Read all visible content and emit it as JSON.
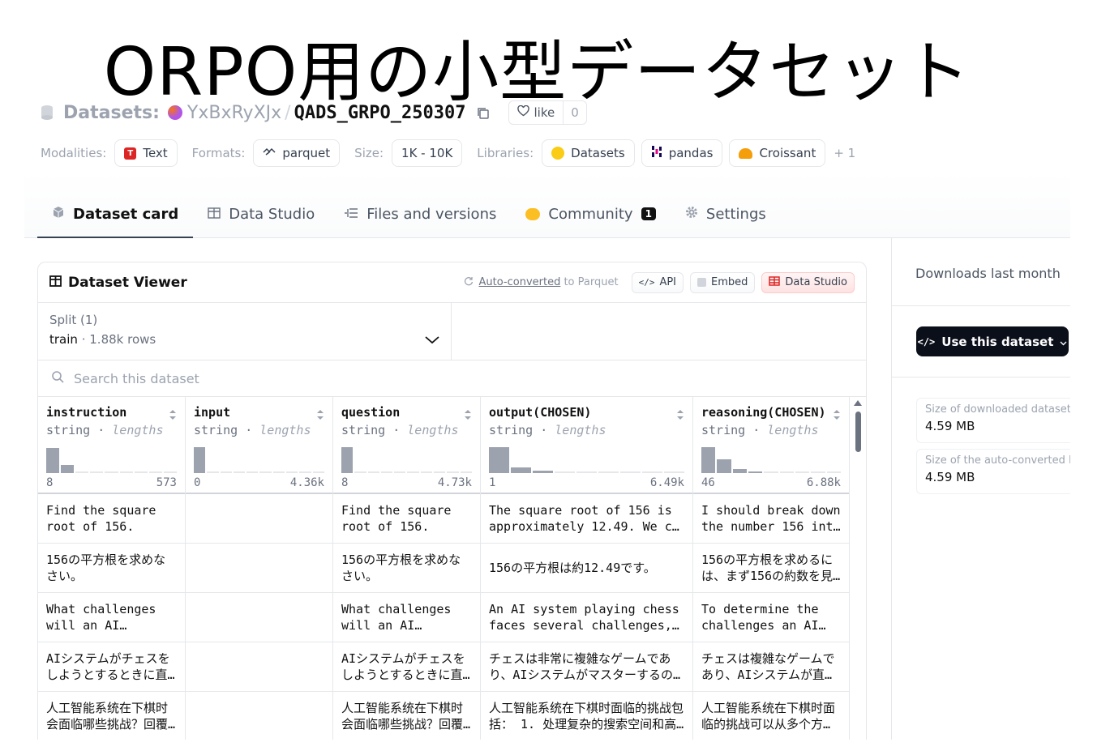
{
  "slide_title": "ORPO用の小型データセット",
  "header": {
    "label": "Datasets:",
    "owner": "YxBxRyXJx",
    "separator": "/",
    "repo": "QADS_GRPO_250307",
    "like_label": "like",
    "like_count": "0"
  },
  "tags": {
    "modalities_label": "Modalities:",
    "modality": "Text",
    "formats_label": "Formats:",
    "format": "parquet",
    "size_label": "Size:",
    "size": "1K - 10K",
    "libraries_label": "Libraries:",
    "libraries": [
      "Datasets",
      "pandas",
      "Croissant"
    ],
    "more": "+ 1"
  },
  "tabs": [
    {
      "label": "Dataset card",
      "icon": "cube-icon"
    },
    {
      "label": "Data Studio",
      "icon": "table-icon"
    },
    {
      "label": "Files and versions",
      "icon": "files-icon"
    },
    {
      "label": "Community",
      "icon": "community-icon",
      "badge": "1"
    },
    {
      "label": "Settings",
      "icon": "gear-icon"
    }
  ],
  "viewer": {
    "title": "Dataset Viewer",
    "auto_converted_link": "Auto-converted",
    "auto_converted_rest": " to Parquet",
    "api_label": "API",
    "embed_label": "Embed",
    "studio_label": "Data Studio",
    "split_label": "Split (1)",
    "split_name": "train",
    "split_dot": "·",
    "split_rows": "1.88k rows",
    "search_placeholder": "Search this dataset"
  },
  "columns": [
    {
      "name": "instruction",
      "type": "string",
      "sep": " · ",
      "stat": "lengths",
      "min": "8",
      "max": "573",
      "hist": [
        0.9,
        0.28,
        0,
        0,
        0,
        0,
        0,
        0,
        0
      ]
    },
    {
      "name": "input",
      "type": "string",
      "sep": " · ",
      "stat": "lengths",
      "min": "0",
      "max": "4.36k",
      "hist": [
        0.95,
        0,
        0,
        0,
        0,
        0,
        0,
        0,
        0,
        0
      ]
    },
    {
      "name": "question",
      "type": "string",
      "sep": " · ",
      "stat": "lengths",
      "min": "8",
      "max": "4.73k",
      "hist": [
        0.95,
        0,
        0,
        0,
        0,
        0,
        0,
        0,
        0,
        0
      ]
    },
    {
      "name": "output(CHOSEN)",
      "type": "string",
      "sep": " · ",
      "stat": "lengths",
      "min": "1",
      "max": "6.49k",
      "hist": [
        0.95,
        0.2,
        0.1,
        0,
        0,
        0,
        0,
        0,
        0
      ]
    },
    {
      "name": "reasoning(CHOSEN)",
      "type": "string",
      "sep": " · ",
      "stat": "lengths",
      "min": "46",
      "max": "6.88k",
      "hist": [
        0.95,
        0.5,
        0.15,
        0.06,
        0,
        0,
        0,
        0,
        0
      ]
    }
  ],
  "rows": [
    [
      "Find the square root of 156.",
      "",
      "Find the square root of 156.",
      "The square root of 156 is approximately 12.49. We c…",
      "I should break down the number 156 int…"
    ],
    [
      "156の平方根を求めなさい。",
      "",
      "156の平方根を求めなさい。",
      "156の平方根は約12.49です。",
      "156の平方根を求めるには、まず156の約数を見…"
    ],
    [
      "What challenges will an AI system…",
      "",
      "What challenges will an AI system…",
      "An AI system playing chess faces several challenges,…",
      "To determine the challenges an AI…"
    ],
    [
      "AIシステムがチェスをしようとするときに直…",
      "",
      "AIシステムがチェスをしようとするときに直…",
      "チェスは非常に複雑なゲームであり、AIシステムがマスターするの…",
      "チェスは複雑なゲームであり、AIシステムが直…"
    ],
    [
      "人工智能系统在下棋时会面临哪些挑战？回覆…",
      "",
      "人工智能系统在下棋时会面临哪些挑战？回覆…",
      "人工智能系统在下棋时面临的挑战包括： 1. 处理复杂的搜索空间和高…",
      "人工智能系统在下棋时面临的挑战可以从多个方…"
    ]
  ],
  "sidebar": {
    "downloads_label": "Downloads last month",
    "use_button": "Use this dataset",
    "stats": [
      {
        "label": "Size of downloaded dataset files:",
        "value": "4.59 MB"
      },
      {
        "label": "Size of the auto-converted Parquet files:",
        "value": "4.59 MB"
      }
    ]
  }
}
